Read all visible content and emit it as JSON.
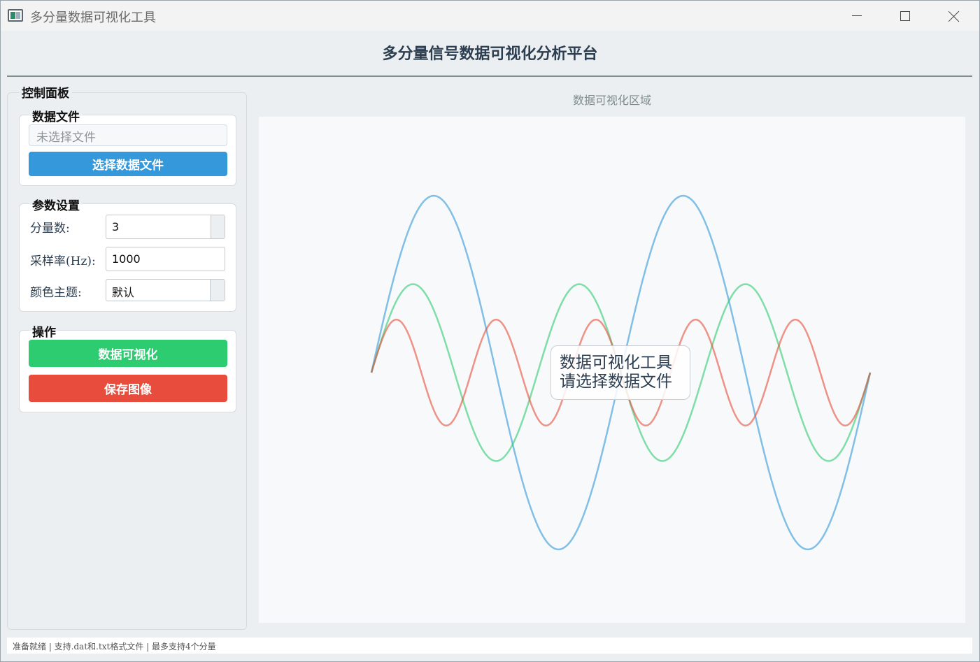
{
  "window": {
    "title": "多分量数据可视化工具"
  },
  "header": {
    "title": "多分量信号数据可视化分析平台"
  },
  "control_panel": {
    "title": "控制面板",
    "data_file": {
      "title": "数据文件",
      "file_placeholder": "未选择文件",
      "select_button": "选择数据文件"
    },
    "params": {
      "title": "参数设置",
      "components_label": "分量数:",
      "components_value": "3",
      "sample_rate_label": "采样率(Hz):",
      "sample_rate_value": "1000",
      "theme_label": "颜色主题:",
      "theme_value": "默认"
    },
    "ops": {
      "title": "操作",
      "visualize_button": "数据可视化",
      "save_button": "保存图像"
    }
  },
  "viz": {
    "caption": "数据可视化区域",
    "placeholder_line1": "数据可视化工具",
    "placeholder_line2": "请选择数据文件"
  },
  "status": {
    "text": "准备就绪 | 支持.dat和.txt格式文件 | 最多支持4个分量"
  },
  "colors": {
    "blue": "#3498db",
    "green": "#2ecc71",
    "red": "#e74c3c",
    "title": "#2c3e50"
  },
  "chart_data": {
    "type": "line",
    "grid": false,
    "series": [
      {
        "color": "#3498db",
        "amplitude": 1.0,
        "cycles": 2.0,
        "phase": 0.0
      },
      {
        "color": "#2ecc71",
        "amplitude": 0.5,
        "cycles": 3.0,
        "phase": 0.0
      },
      {
        "color": "#e74c3c",
        "amplitude": 0.3,
        "cycles": 5.0,
        "phase": 0.0
      }
    ],
    "x_range": [
      0,
      1
    ],
    "y_range": [
      -1,
      1
    ]
  }
}
